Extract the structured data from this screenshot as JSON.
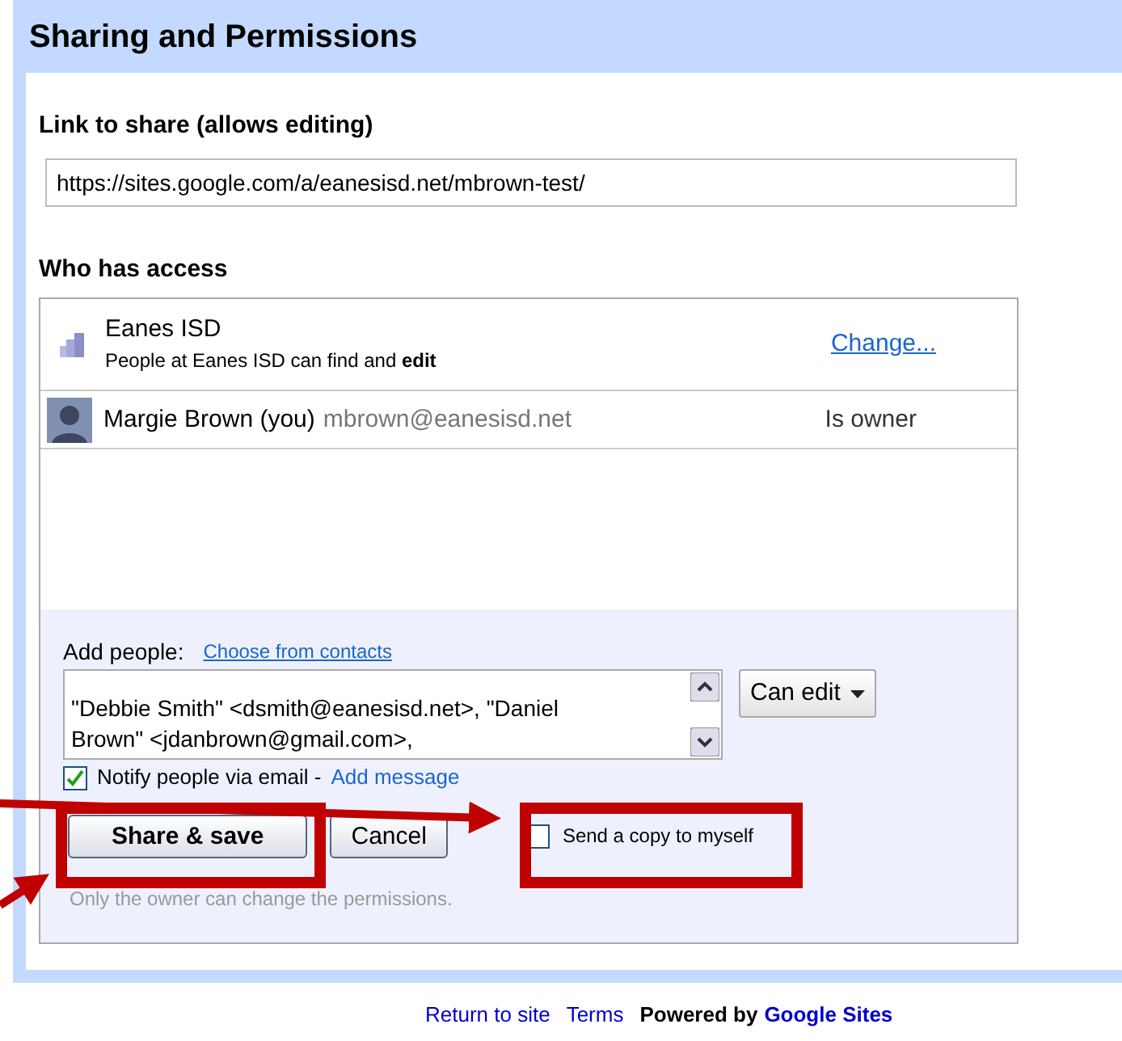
{
  "dialog": {
    "title": "Sharing and Permissions"
  },
  "link": {
    "label": "Link to share (allows editing)",
    "value": "https://sites.google.com/a/eanesisd.net/mbrown-test/"
  },
  "access": {
    "label": "Who has access",
    "rows": [
      {
        "kind": "domain",
        "name": "Eanes ISD",
        "detail": "People at Eanes ISD can find and **edit**",
        "action": "Change..."
      },
      {
        "kind": "person",
        "name": "Margie Brown (you)",
        "email": "mbrown@eanesisd.net",
        "role": "Is owner"
      }
    ]
  },
  "add_people": {
    "label": "Add people:",
    "link": "Choose from contacts",
    "lines": [
      "\"Debbie Smith\" <dsmith@eanesisd.net>, \"Daniel",
      "Brown\" <jdanbrown@gmail.com>,"
    ],
    "permission": "Can edit"
  },
  "notify": {
    "label": "Notify people via email -",
    "link": "Add message",
    "checked": true
  },
  "buttons": [
    {
      "label": "Share & save",
      "primary": true
    },
    {
      "label": "Cancel",
      "primary": false
    }
  ],
  "send_copy": {
    "label": "Send a copy to myself",
    "checked": false
  },
  "note": "Only the owner can change the permissions.",
  "footer": {
    "links": [
      "Return to site",
      "Terms"
    ],
    "powered": "Powered by",
    "brand": "Google Sites"
  }
}
